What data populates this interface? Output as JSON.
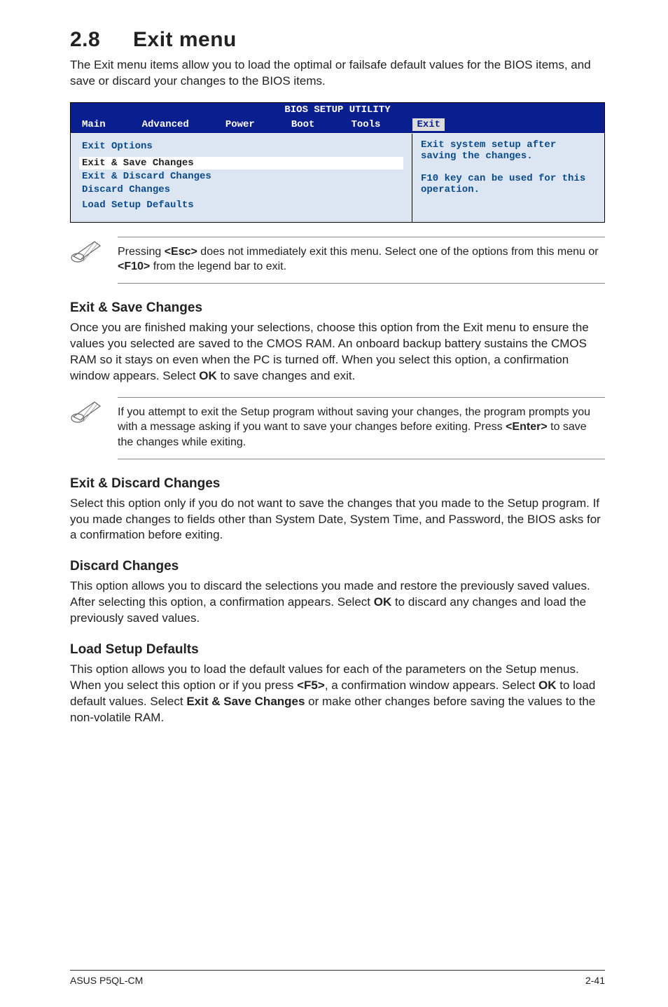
{
  "section": {
    "number": "2.8",
    "title": "Exit menu",
    "intro": "The Exit menu items allow you to load the optimal or failsafe default values for the BIOS items, and save or discard your changes to the BIOS items."
  },
  "bios": {
    "header": "BIOS SETUP UTILITY",
    "tabs": [
      "Main",
      "Advanced",
      "Power",
      "Boot",
      "Tools",
      "Exit"
    ],
    "active_tab": "Exit",
    "main_heading": "Exit Options",
    "items": [
      {
        "label": "Exit & Save Changes",
        "selected": true
      },
      {
        "label": "Exit & Discard Changes",
        "selected": false
      },
      {
        "label": "Discard Changes",
        "selected": false
      },
      {
        "label": "",
        "selected": false
      },
      {
        "label": "Load Setup Defaults",
        "selected": false
      }
    ],
    "side_help": "Exit system setup after saving the changes.\n\nF10 key can be used for this operation."
  },
  "note_esc": {
    "pre": "Pressing ",
    "key1": "<Esc>",
    "mid": " does not immediately exit this menu. Select one of the options from this menu or ",
    "key2": "<F10>",
    "post": " from the legend bar to exit."
  },
  "exit_save": {
    "heading": "Exit & Save Changes",
    "body_pre": "Once you are finished making your selections, choose this option from the Exit menu to ensure the values you selected are saved to the CMOS RAM. An onboard backup battery sustains the CMOS RAM so it stays on even when the PC is turned off. When you select this option, a confirmation window appears. Select ",
    "ok": "OK",
    "body_post": " to save changes and exit."
  },
  "note_save": {
    "pre": " If you attempt to exit the Setup program without saving your changes, the program prompts you with a message asking if you want to save your changes before exiting. Press ",
    "key": "<Enter>",
    "post": " to save the changes while exiting."
  },
  "exit_discard": {
    "heading": "Exit & Discard Changes",
    "body": "Select this option only if you do not want to save the changes that you made to the Setup program. If you made changes to fields other than System Date, System Time, and Password, the BIOS asks for a confirmation before exiting."
  },
  "discard": {
    "heading": "Discard Changes",
    "body_pre": "This option allows you to discard the selections you made and restore the previously saved values. After selecting this option, a confirmation appears. Select ",
    "ok": "OK",
    "body_post": " to discard any changes and load the previously saved values."
  },
  "load_defaults": {
    "heading": "Load Setup Defaults",
    "body_pre": "This option allows you to load the default values for each of the parameters on the Setup menus. When you select this option or if you press ",
    "f5": "<F5>",
    "body_mid1": ", a confirmation window appears. Select ",
    "ok": "OK",
    "body_mid2": " to load default values. Select ",
    "exit_save": "Exit & Save Changes",
    "body_post": " or make other changes before saving the values to the non-volatile RAM."
  },
  "footer": {
    "left": "ASUS P5QL-CM",
    "right": "2-41"
  }
}
